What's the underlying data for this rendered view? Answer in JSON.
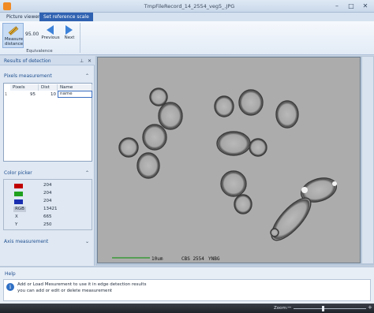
{
  "window": {
    "title": "TmpFileRecord_14_2554_veg5_.JPG",
    "controls": [
      "–",
      "□",
      "✕"
    ]
  },
  "tabs": [
    {
      "label": "Picture viewer",
      "active": false
    },
    {
      "label": "Set reference scale",
      "active": true
    }
  ],
  "ribbon": {
    "measure_label_1": "Measure",
    "measure_label_2": "distance",
    "distance_value": "95.00",
    "previous_label": "Previous",
    "next_label": "Next",
    "group_label": "Equivalence",
    "measure_icon": "ruler-pencil-icon"
  },
  "left_panel": {
    "title": "Results of detection",
    "pin_icon": "pin-icon",
    "close_icon": "close-icon",
    "pixels_section": "Pixels measurement",
    "columns": [
      "Pixels",
      "Dist",
      "Name"
    ],
    "row_index": "1",
    "row": {
      "pixels": "95",
      "dist": "10",
      "name": "name"
    },
    "color_section": "Color picker",
    "colors": {
      "r_value": "204",
      "g_value": "204",
      "b_value": "204",
      "rgb_label": "RGB",
      "rgb_value": "13421",
      "x_label": "X",
      "x_value": "665",
      "y_label": "Y",
      "y_value": "250",
      "r_color": "#c00000",
      "g_color": "#1fa01f",
      "b_color": "#1a2fb0"
    },
    "axis_section": "Axis measurement"
  },
  "image": {
    "scale_text": "10um",
    "caption": "CBS 2554",
    "author": "YNBG",
    "scale_bar_color": "#3a9a3a"
  },
  "help": {
    "title": "Help",
    "line1": "Add or Load Mesurement to use it in edge detection results",
    "line2": "you can add or edit or delete measurement"
  },
  "status": {
    "zoom_label": "Zoom:",
    "zoom_level": 0.4
  }
}
